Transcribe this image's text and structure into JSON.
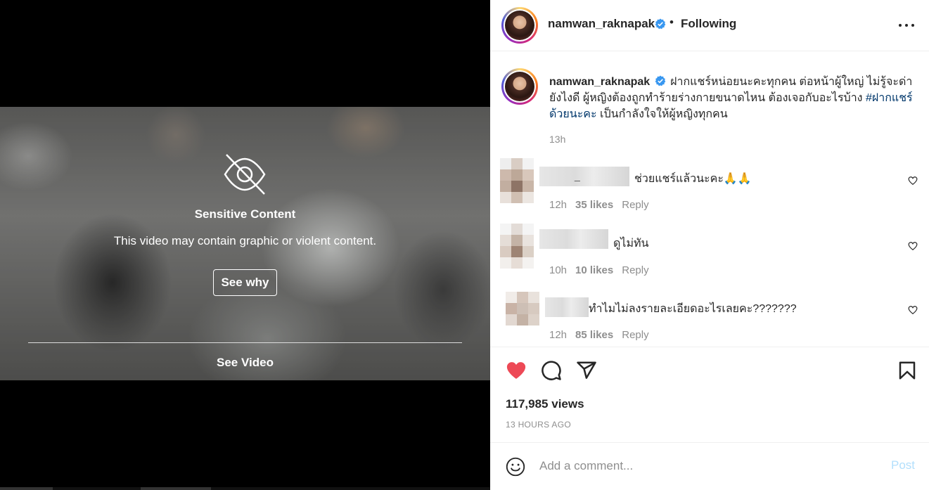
{
  "sensitive": {
    "title": "Sensitive Content",
    "description": "This video may contain graphic or violent content.",
    "see_why_label": "See why",
    "see_video_label": "See Video"
  },
  "header": {
    "username": "namwan_raknapak",
    "separator": "•",
    "following_label": "Following",
    "more_icon": "more-horizontal-icon",
    "verified_color": "#3897f0"
  },
  "caption": {
    "username": "namwan_raknapak",
    "text_before": "ฝากแชร์หน่อยนะคะทุกคน ต่อหน้าผู้ใหญ่ ไม่รู้จะด่ายังไงดี ผู้หญิงต้องถูกทำร้ายร่างกายขนาดไหน ต้องเจอกับอะไรบ้าง ",
    "hashtag": "#ฝากแชร์ด้วยนะคะ",
    "text_after": " เป็นกำลังใจให้ผู้หญิงทุกคน",
    "time": "13h"
  },
  "comments": [
    {
      "text": "ช่วยแชร์แล้วนะคะ🙏🙏",
      "time": "12h",
      "likes": "35 likes",
      "reply": "Reply",
      "visible_name_fragment": "_"
    },
    {
      "text": "ดูไม่ทัน",
      "time": "10h",
      "likes": "10 likes",
      "reply": "Reply"
    },
    {
      "text": "ทำไมไม่ลงรายละเอียดอะไรเลยคะ???????",
      "time": "12h",
      "likes": "85 likes",
      "reply": "Reply"
    }
  ],
  "actions": {
    "like_icon": "heart-filled-icon",
    "comment_icon": "comment-icon",
    "share_icon": "share-icon",
    "save_icon": "bookmark-icon",
    "like_color": "#ed4956",
    "views": "117,985 views",
    "time_ago": "13 HOURS AGO"
  },
  "add_comment": {
    "placeholder": "Add a comment...",
    "post_label": "Post",
    "post_color": "#b2dffc"
  }
}
